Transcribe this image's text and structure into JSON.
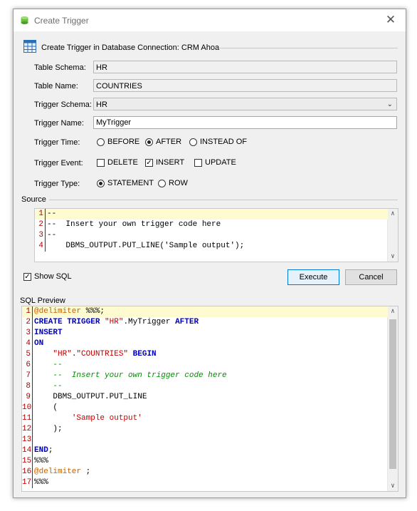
{
  "window": {
    "title": "Create Trigger",
    "close_glyph": "✕"
  },
  "header": {
    "title": "Create Trigger in Database Connection: CRM Ahoa"
  },
  "form": {
    "table_schema": {
      "label": "Table Schema:",
      "value": "HR"
    },
    "table_name": {
      "label": "Table Name:",
      "value": "COUNTRIES"
    },
    "trigger_schema": {
      "label": "Trigger Schema:",
      "value": "HR"
    },
    "trigger_name": {
      "label": "Trigger Name:",
      "value": "MyTrigger"
    },
    "trigger_time": {
      "label": "Trigger Time:",
      "options": [
        "BEFORE",
        "AFTER",
        "INSTEAD OF"
      ],
      "selected": "AFTER"
    },
    "trigger_event": {
      "label": "Trigger Event:",
      "options": [
        "DELETE",
        "INSERT",
        "UPDATE"
      ],
      "checked": [
        "INSERT"
      ]
    },
    "trigger_type": {
      "label": "Trigger Type:",
      "options": [
        "STATEMENT",
        "ROW"
      ],
      "selected": "STATEMENT"
    }
  },
  "source": {
    "label": "Source",
    "lines": [
      {
        "n": "1",
        "text": "--"
      },
      {
        "n": "2",
        "text": "--  Insert your own trigger code here"
      },
      {
        "n": "3",
        "text": "--"
      },
      {
        "n": "4",
        "text": "    DBMS_OUTPUT.PUT_LINE('Sample output');"
      }
    ]
  },
  "controls": {
    "show_sql": {
      "label": "Show SQL",
      "checked": true
    },
    "execute": "Execute",
    "cancel": "Cancel"
  },
  "preview": {
    "label": "SQL Preview",
    "lines": [
      {
        "n": "1",
        "segs": [
          [
            "dl",
            "@delimiter "
          ],
          [
            "",
            "%%%;"
          ]
        ]
      },
      {
        "n": "2",
        "segs": [
          [
            "kw",
            "CREATE TRIGGER "
          ],
          [
            "str",
            "\"HR\""
          ],
          [
            "",
            ".MyTrigger "
          ],
          [
            "kw",
            "AFTER"
          ]
        ]
      },
      {
        "n": "3",
        "segs": [
          [
            "kw",
            "INSERT"
          ]
        ]
      },
      {
        "n": "4",
        "segs": [
          [
            "kw",
            "ON"
          ]
        ]
      },
      {
        "n": "5",
        "segs": [
          [
            "",
            "    "
          ],
          [
            "str",
            "\"HR\""
          ],
          [
            "",
            "."
          ],
          [
            "str",
            "\"COUNTRIES\""
          ],
          [
            "",
            " "
          ],
          [
            "kw",
            "BEGIN"
          ]
        ]
      },
      {
        "n": "6",
        "segs": [
          [
            "",
            "    "
          ],
          [
            "cmn",
            "--"
          ]
        ]
      },
      {
        "n": "7",
        "segs": [
          [
            "",
            "    "
          ],
          [
            "cm",
            "--  Insert your own trigger code here"
          ]
        ]
      },
      {
        "n": "8",
        "segs": [
          [
            "",
            "    "
          ],
          [
            "cmn",
            "--"
          ]
        ]
      },
      {
        "n": "9",
        "segs": [
          [
            "",
            "    DBMS_OUTPUT.PUT_LINE"
          ]
        ]
      },
      {
        "n": "10",
        "segs": [
          [
            "",
            "    ("
          ]
        ]
      },
      {
        "n": "11",
        "segs": [
          [
            "",
            "        "
          ],
          [
            "str",
            "'Sample output'"
          ]
        ]
      },
      {
        "n": "12",
        "segs": [
          [
            "",
            "    );"
          ]
        ]
      },
      {
        "n": "13",
        "segs": []
      },
      {
        "n": "14",
        "segs": [
          [
            "kw",
            "END"
          ],
          [
            "",
            ";"
          ]
        ]
      },
      {
        "n": "15",
        "segs": [
          [
            "",
            "%%%"
          ]
        ]
      },
      {
        "n": "16",
        "segs": [
          [
            "dl",
            "@delimiter "
          ],
          [
            "",
            ";"
          ]
        ]
      },
      {
        "n": "17",
        "segs": [
          [
            "",
            "%%%"
          ]
        ]
      }
    ]
  },
  "colors": {
    "accent": "#0078d7",
    "line_highlight": "#fffbd0",
    "keyword": "#0000c0",
    "string": "#c00000",
    "comment": "#009000",
    "delimiter": "#c56400"
  }
}
